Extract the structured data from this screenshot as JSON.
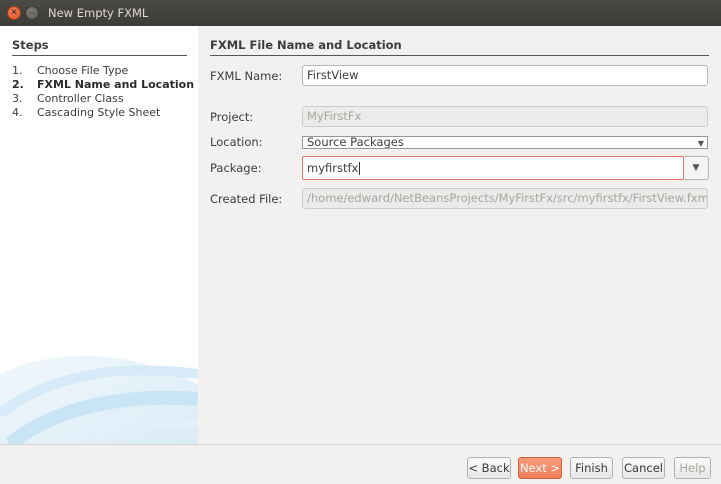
{
  "window": {
    "title": "New Empty FXML",
    "close_glyph": "✕",
    "minimize_glyph": "–"
  },
  "steps": {
    "heading": "Steps",
    "items": [
      {
        "num": "1.",
        "label": "Choose File Type",
        "active": false
      },
      {
        "num": "2.",
        "label": "FXML Name and Location",
        "active": true
      },
      {
        "num": "3.",
        "label": "Controller Class",
        "active": false
      },
      {
        "num": "4.",
        "label": "Cascading Style Sheet",
        "active": false
      }
    ]
  },
  "panel": {
    "title": "FXML File Name and Location",
    "fxml_name": {
      "label": "FXML Name:",
      "value": "FirstView"
    },
    "project": {
      "label": "Project:",
      "value": "MyFirstFx"
    },
    "location": {
      "label": "Location:",
      "value": "Source Packages"
    },
    "package": {
      "label": "Package:",
      "value": "myfirstfx"
    },
    "created_file": {
      "label": "Created File:",
      "value": "/home/edward/NetBeansProjects/MyFirstFx/src/myfirstfx/FirstView.fxml"
    }
  },
  "buttons": {
    "back": "< Back",
    "next": "Next >",
    "finish": "Finish",
    "cancel": "Cancel",
    "help": "Help"
  },
  "colors": {
    "accent": "#ee7f5a",
    "titlebar": "#3c3b37"
  }
}
